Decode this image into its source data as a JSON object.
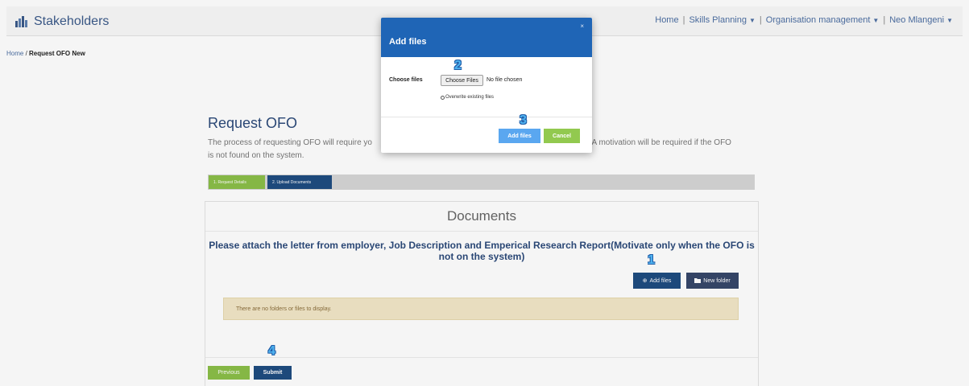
{
  "navbar": {
    "brand": "Stakeholders",
    "links": {
      "home": "Home",
      "skills_planning": "Skills Planning",
      "organisation_management": "Organisation management",
      "user": "Neo Mlangeni"
    },
    "separator": "|",
    "caret": "▼"
  },
  "breadcrumb": {
    "home": "Home",
    "separator": " / ",
    "current": "Request OFO New"
  },
  "page": {
    "title": "Request OFO",
    "description_left": "The process of requesting OFO will require yo",
    "description_right": "n. A motivation will be required if the OFO",
    "description_line2": "is not found on the system."
  },
  "wizard": {
    "steps": [
      {
        "label": "1. Request Details"
      },
      {
        "label": "2. Upload Documents"
      }
    ]
  },
  "documents": {
    "heading": "Documents",
    "note": "Please attach the letter from employer, Job Description and Emperical Research Report(Motivate only when the OFO is not on the system)",
    "add_files_label": "Add files",
    "new_folder_label": "New folder",
    "empty_message": "There are no folders or files to display."
  },
  "footer_buttons": {
    "previous": "Previous",
    "submit": "Submit"
  },
  "modal": {
    "title": "Add files",
    "close": "×",
    "choose_label": "Choose files",
    "choose_button": "Choose Files",
    "file_status": "No file chosen",
    "overwrite_label": "Overwrite existing files",
    "add_button": "Add files",
    "cancel_button": "Cancel"
  },
  "callouts": [
    "1",
    "2",
    "3",
    "4"
  ],
  "colors": {
    "primary": "#1f4c80",
    "modal_header": "#1f65b6",
    "success": "#8bbf48",
    "warning_bg": "#f2e7c7",
    "callout": "#4fb3f0"
  }
}
